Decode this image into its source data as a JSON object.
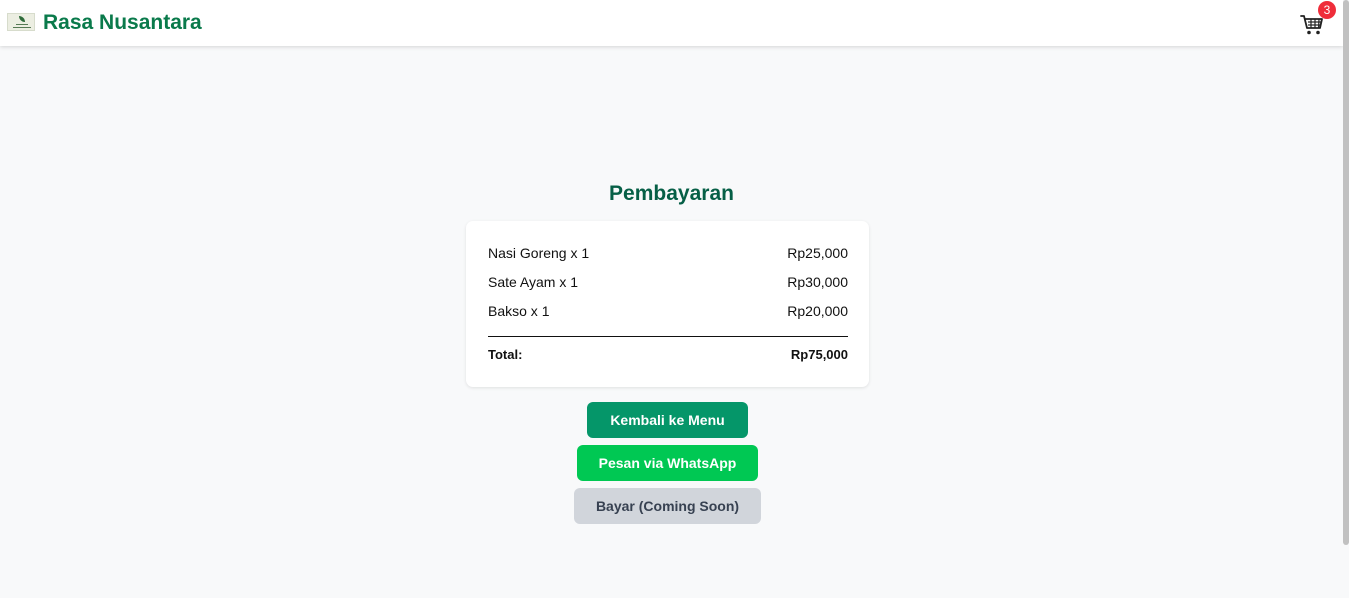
{
  "navbar": {
    "brand": "Rasa Nusantara",
    "cart_count": "3"
  },
  "page": {
    "title": "Pembayaran"
  },
  "order": {
    "items": [
      {
        "name": "Nasi Goreng x 1",
        "price": "Rp25,000"
      },
      {
        "name": "Sate Ayam x 1",
        "price": "Rp30,000"
      },
      {
        "name": "Bakso x 1",
        "price": "Rp20,000"
      }
    ],
    "total_label": "Total:",
    "total_value": "Rp75,000"
  },
  "actions": {
    "back_to_menu": "Kembali ke Menu",
    "order_whatsapp": "Pesan via WhatsApp",
    "pay": "Bayar (Coming Soon)"
  },
  "colors": {
    "brand": "#0a7a4b",
    "title": "#065f46",
    "menu_button": "#059669",
    "whatsapp_button": "#00c853",
    "pay_button": "#d1d5db",
    "badge": "#ef2d3a"
  },
  "icons": {
    "logo": "rasa-nusantara-logo",
    "cart": "shopping-cart-icon"
  }
}
